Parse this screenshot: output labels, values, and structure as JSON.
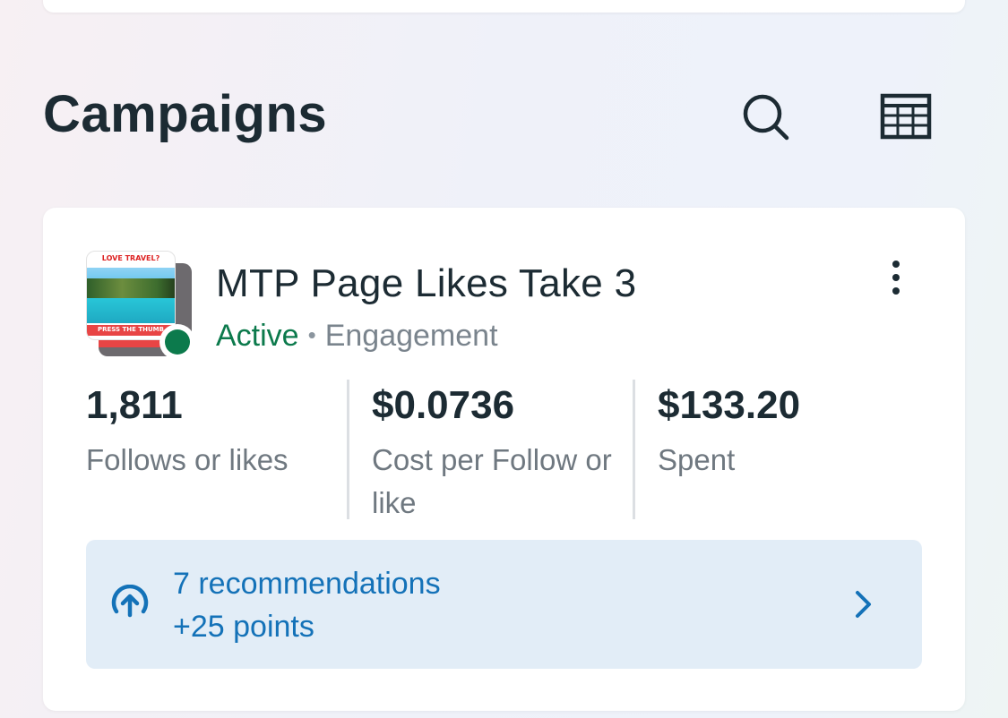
{
  "header": {
    "title": "Campaigns"
  },
  "campaign": {
    "thumbnail": {
      "top_text": "LOVE TRAVEL?",
      "band_text": "PRESS THE THUMB"
    },
    "name": "MTP Page Likes Take 3",
    "status": "Active",
    "separator": "•",
    "objective": "Engagement",
    "status_color": "#0c7a4c",
    "metrics": [
      {
        "value": "1,811",
        "label": "Follows or likes"
      },
      {
        "value": "$0.0736",
        "label": "Cost per Follow or like"
      },
      {
        "value": "$133.20",
        "label": "Spent"
      }
    ],
    "recommendations": {
      "title": "7 recommendations",
      "points": "+25 points",
      "accent_color": "#1472b8"
    }
  },
  "icons": {
    "search": "search-icon",
    "table": "table-view-icon",
    "more": "more-vertical-icon",
    "recommendation": "arrow-up-circle-icon",
    "chevron": "chevron-right-icon"
  }
}
